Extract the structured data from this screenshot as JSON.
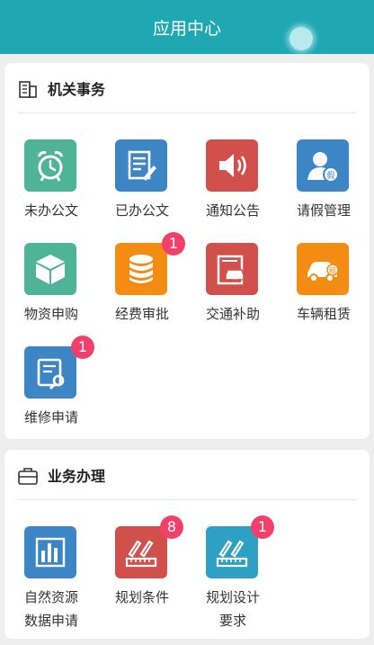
{
  "header": {
    "title": "应用中心"
  },
  "sections": [
    {
      "title": "机关事务",
      "items": [
        {
          "label": "未办公文",
          "color": "#4fb398",
          "icon": "alarm-clock-icon"
        },
        {
          "label": "已办公文",
          "color": "#3d86c6",
          "icon": "document-edit-icon"
        },
        {
          "label": "通知公告",
          "color": "#d2504c",
          "icon": "speaker-icon"
        },
        {
          "label": "请假管理",
          "color": "#3d86c6",
          "icon": "user-leave-icon"
        },
        {
          "label": "物资申购",
          "color": "#4fb398",
          "icon": "package-box-icon"
        },
        {
          "label": "经费审批",
          "color": "#f28c12",
          "icon": "coins-stack-icon",
          "badge": "1"
        },
        {
          "label": "交通补助",
          "color": "#d2504c",
          "icon": "car-subsidy-icon"
        },
        {
          "label": "车辆租赁",
          "color": "#f28c12",
          "icon": "car-rental-icon"
        },
        {
          "label": "维修申请",
          "color": "#3d86c6",
          "icon": "repair-document-icon",
          "badge": "1"
        }
      ]
    },
    {
      "title": "业务办理",
      "items": [
        {
          "label": "自然资源\n数据申请",
          "color": "#3d86c6",
          "icon": "bar-chart-icon"
        },
        {
          "label": "规划条件",
          "color": "#d2504c",
          "icon": "ruler-pen-icon",
          "badge": "8"
        },
        {
          "label": "规划设计\n要求",
          "color": "#2ea0c4",
          "icon": "ruler-pen-icon",
          "badge": "1"
        }
      ]
    }
  ]
}
